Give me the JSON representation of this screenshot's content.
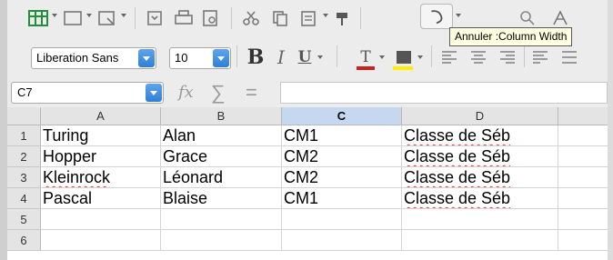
{
  "toolbar": {
    "tooltip": "Annuler :Column Width"
  },
  "format": {
    "font_name": "Liberation Sans",
    "font_size": "10",
    "bold_label": "B",
    "italic_label": "I",
    "underline_label": "U",
    "font_color_label": "T",
    "colors": {
      "font_color": "#c9211e",
      "highlight": "#ffee00"
    }
  },
  "formula": {
    "name_box": "C7",
    "fx": "fx",
    "sum": "∑",
    "eq": "=",
    "content": ""
  },
  "sheet": {
    "columns": [
      "A",
      "B",
      "C",
      "D"
    ],
    "active_column": "C",
    "rows": [
      {
        "num": "1",
        "cells": [
          "Turing",
          "Alan",
          "CM1",
          "Classe de Séb"
        ]
      },
      {
        "num": "2",
        "cells": [
          "Hopper",
          "Grace",
          "CM2",
          "Classe de Séb"
        ]
      },
      {
        "num": "3",
        "cells": [
          "Kleinrock",
          "Léonard",
          "CM2",
          "Classe de Séb"
        ]
      },
      {
        "num": "4",
        "cells": [
          "Pascal",
          "Blaise",
          "CM1",
          "Classe de Séb"
        ]
      },
      {
        "num": "5",
        "cells": [
          "",
          "",
          "",
          ""
        ]
      },
      {
        "num": "6",
        "cells": [
          "",
          "",
          "",
          ""
        ]
      }
    ]
  }
}
